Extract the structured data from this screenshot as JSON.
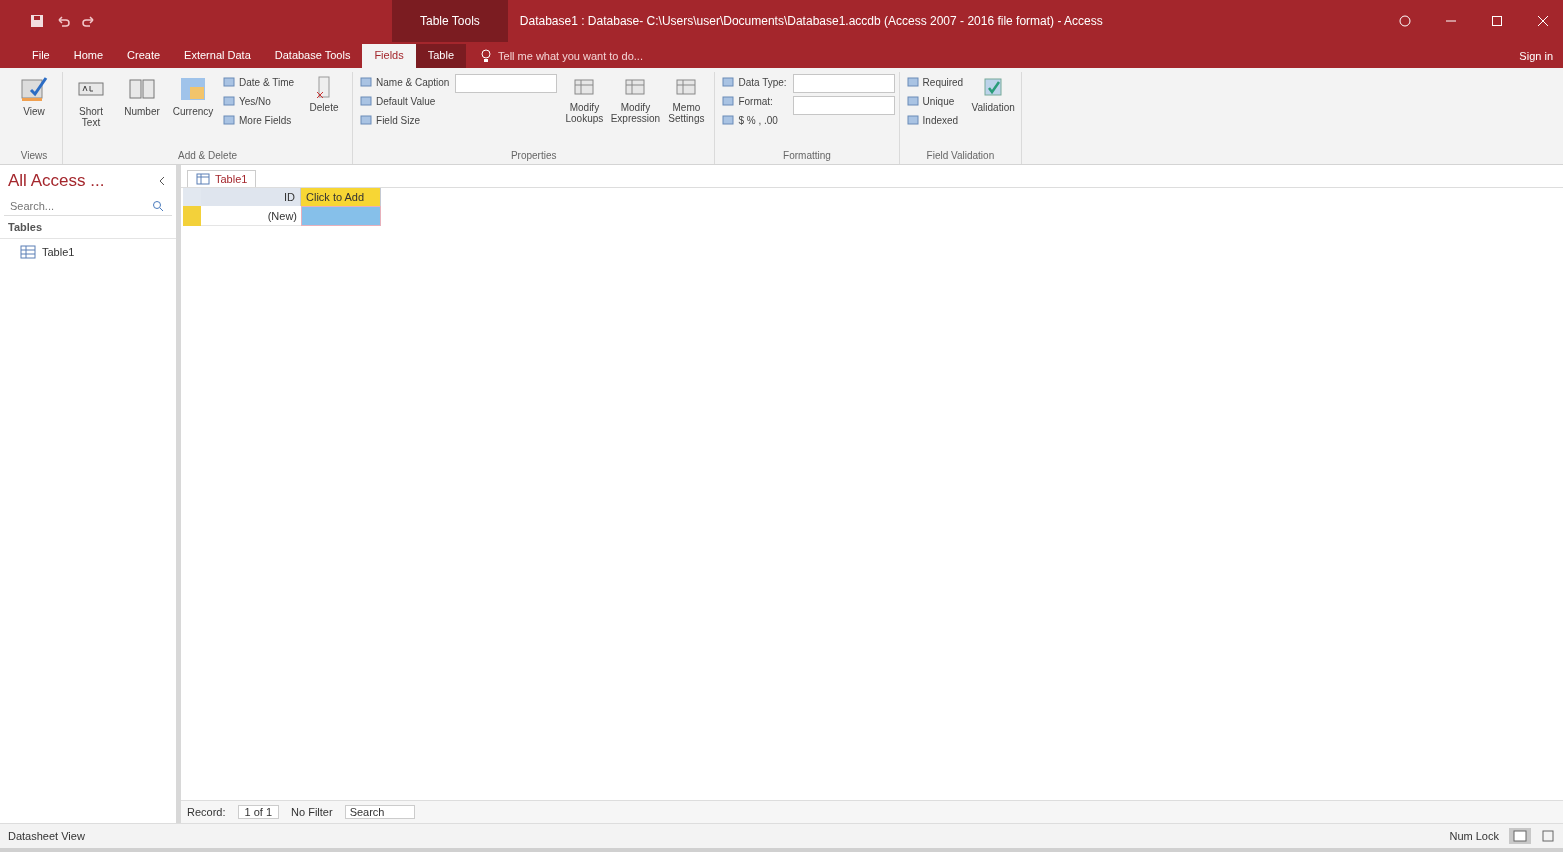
{
  "window": {
    "title": "Database1 : Database- C:\\Users\\user\\Documents\\Database1.accdb (Access 2007 - 2016 file format) - Access",
    "context_tab": "Table Tools"
  },
  "tabs": [
    {
      "label": "File",
      "selected": false
    },
    {
      "label": "Home",
      "selected": false
    },
    {
      "label": "Create",
      "selected": false
    },
    {
      "label": "External Data",
      "selected": false
    },
    {
      "label": "Database Tools",
      "selected": false
    },
    {
      "label": "Fields",
      "selected": true
    },
    {
      "label": "Table",
      "selected": false
    }
  ],
  "tell_me": {
    "placeholder": "Tell me what you want to do..."
  },
  "sign_in": "Sign in",
  "ribbon": {
    "groups": [
      {
        "name": "Views",
        "large": [
          {
            "label": "View"
          }
        ]
      },
      {
        "name": "Add & Delete",
        "large": [
          {
            "label": "Short Text"
          },
          {
            "label": "Number"
          },
          {
            "label": "Currency"
          }
        ],
        "small": [
          {
            "label": "Date & Time"
          },
          {
            "label": "Yes/No"
          },
          {
            "label": "More Fields"
          }
        ],
        "after": [
          {
            "label": "Delete"
          }
        ]
      },
      {
        "name": "Properties",
        "small": [
          {
            "label": "Name & Caption"
          },
          {
            "label": "Default Value"
          },
          {
            "label": "Field Size"
          }
        ],
        "after": [
          {
            "label": "Modify Lookups"
          },
          {
            "label": "Modify Expression"
          },
          {
            "label": "Memo Settings"
          }
        ]
      },
      {
        "name": "Formatting",
        "small": [
          {
            "label": "Data Type:"
          },
          {
            "label": "Format:"
          },
          {
            "label": "$  %  ,  .00"
          }
        ]
      },
      {
        "name": "Field Validation",
        "small": [
          {
            "label": "Required"
          },
          {
            "label": "Unique"
          },
          {
            "label": "Indexed"
          }
        ],
        "after": [
          {
            "label": "Validation"
          }
        ]
      }
    ]
  },
  "nav_pane": {
    "title": "All Access ...",
    "search": {
      "placeholder": "Search..."
    },
    "section": "Tables",
    "items": [
      {
        "label": "Table1",
        "selected": false
      }
    ]
  },
  "document_tab": {
    "label": "Table1"
  },
  "datasheet": {
    "columns": [
      {
        "label": "ID",
        "selected": false
      },
      {
        "label": "Click to Add",
        "selected": true
      }
    ],
    "rows": [
      {
        "id": "(New)",
        "selected": true
      }
    ]
  },
  "record_nav": {
    "label": "Record:",
    "position": "1 of 1",
    "filter": "No Filter",
    "search": "Search"
  },
  "status_bar": {
    "left": "Datasheet View",
    "right": "Num Lock"
  }
}
